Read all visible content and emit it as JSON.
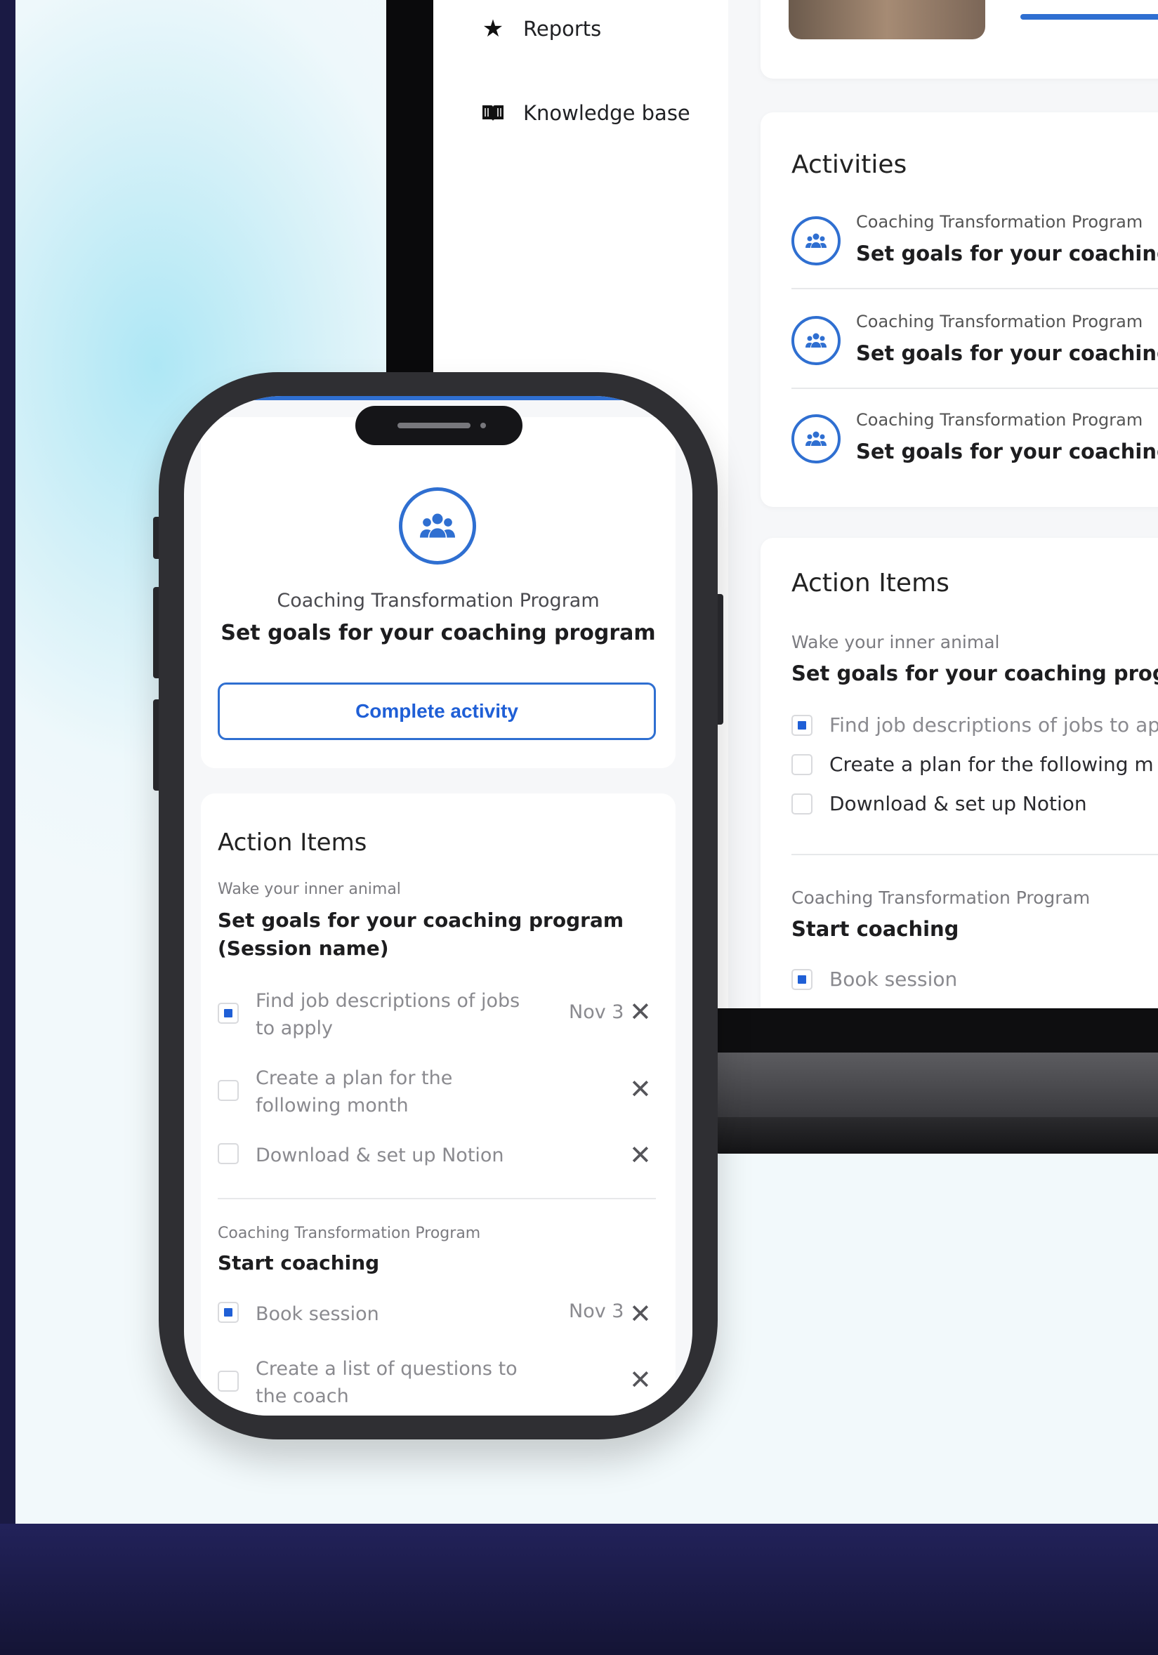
{
  "sidebar": {
    "items": [
      {
        "label": "Reports",
        "icon": "star-icon"
      },
      {
        "label": "Knowledge base",
        "icon": "book-icon"
      }
    ]
  },
  "laptop": {
    "activities": {
      "title": "Activities",
      "items": [
        {
          "program": "Coaching Transformation Program",
          "title": "Set goals for your coaching pr"
        },
        {
          "program": "Coaching Transformation Program",
          "title": "Set goals for your coaching pr"
        },
        {
          "program": "Coaching Transformation Program",
          "title": "Set goals for your coaching pr"
        }
      ]
    },
    "action_items": {
      "title": "Action Items",
      "group1": {
        "program": "Wake your inner animal",
        "title": "Set goals for your coaching program",
        "items": [
          {
            "label": "Find job descriptions of jobs to ap",
            "checked": true
          },
          {
            "label": "Create a plan for the following m",
            "checked": false
          },
          {
            "label": "Download & set up Notion",
            "checked": false
          }
        ]
      },
      "group2": {
        "program": "Coaching Transformation Program",
        "title": "Start coaching",
        "items": [
          {
            "label": "Book session",
            "checked": true
          }
        ]
      }
    }
  },
  "phone": {
    "activity": {
      "program": "Coaching Transformation Program",
      "title": "Set goals for your coaching program",
      "button": "Complete activity"
    },
    "action_items": {
      "title": "Action Items",
      "group1": {
        "program": "Wake your inner animal",
        "title_line1": "Set goals for your coaching program",
        "title_line2": "(Session name)",
        "items": [
          {
            "label": "Find job descriptions of jobs to apply",
            "date": "Nov 3",
            "checked": true
          },
          {
            "label": "Create a plan for the following month",
            "date": "",
            "checked": false
          },
          {
            "label": "Download & set up Notion",
            "date": "",
            "checked": false
          }
        ]
      },
      "group2": {
        "program": "Coaching Transformation Program",
        "title": "Start coaching",
        "items": [
          {
            "label": "Book session",
            "date": "Nov 3",
            "checked": true
          },
          {
            "label": "Create a list of questions to the coach",
            "date": "",
            "checked": false
          }
        ]
      }
    }
  },
  "colors": {
    "accent": "#2f6fd1",
    "checkbox_fill": "#1f5fd6"
  }
}
